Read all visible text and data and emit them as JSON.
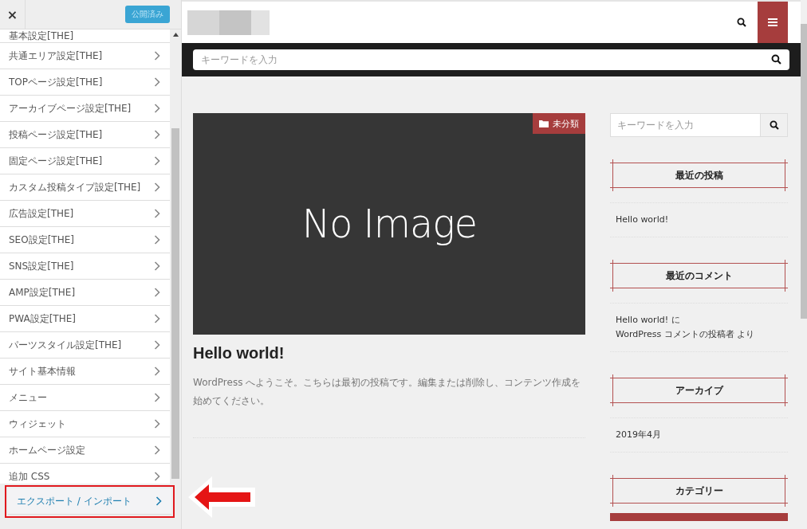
{
  "customizer": {
    "close_label": "×",
    "publish_button": "公開済み",
    "menu_items": [
      {
        "label": "基本設定[THE]",
        "selected": false
      },
      {
        "label": "共通エリア設定[THE]",
        "selected": false
      },
      {
        "label": "TOPページ設定[THE]",
        "selected": false
      },
      {
        "label": "アーカイブページ設定[THE]",
        "selected": false
      },
      {
        "label": "投稿ページ設定[THE]",
        "selected": false
      },
      {
        "label": "固定ページ設定[THE]",
        "selected": false
      },
      {
        "label": "カスタム投稿タイプ設定[THE]",
        "selected": false
      },
      {
        "label": "広告設定[THE]",
        "selected": false
      },
      {
        "label": "SEO設定[THE]",
        "selected": false
      },
      {
        "label": "SNS設定[THE]",
        "selected": false
      },
      {
        "label": "AMP設定[THE]",
        "selected": false
      },
      {
        "label": "PWA設定[THE]",
        "selected": false
      },
      {
        "label": "パーツスタイル設定[THE]",
        "selected": false
      },
      {
        "label": "サイト基本情報",
        "selected": false
      },
      {
        "label": "メニュー",
        "selected": false
      },
      {
        "label": "ウィジェット",
        "selected": false
      },
      {
        "label": "ホームページ設定",
        "selected": false
      },
      {
        "label": "追加 CSS",
        "selected": false
      },
      {
        "label": "エクスポート / インポート",
        "selected": true
      }
    ]
  },
  "preview": {
    "search": {
      "placeholder": "キーワードを入力"
    },
    "post": {
      "category": "未分類",
      "image_text": "No Image",
      "title": "Hello world!",
      "excerpt": "WordPress へようこそ。こちらは最初の投稿です。編集または削除し、コンテンツ作成を始めてください。"
    },
    "sidebar": {
      "search": {
        "placeholder": "キーワードを入力"
      },
      "widgets": [
        {
          "title": "最近の投稿",
          "entries": [
            [
              "Hello world!"
            ]
          ]
        },
        {
          "title": "最近のコメント",
          "entries": [
            [
              "Hello world! に",
              "WordPress コメントの投稿者 より"
            ]
          ]
        },
        {
          "title": "アーカイブ",
          "entries": [
            [
              "2019年4月"
            ]
          ]
        },
        {
          "title": "カテゴリー"
        }
      ]
    }
  }
}
